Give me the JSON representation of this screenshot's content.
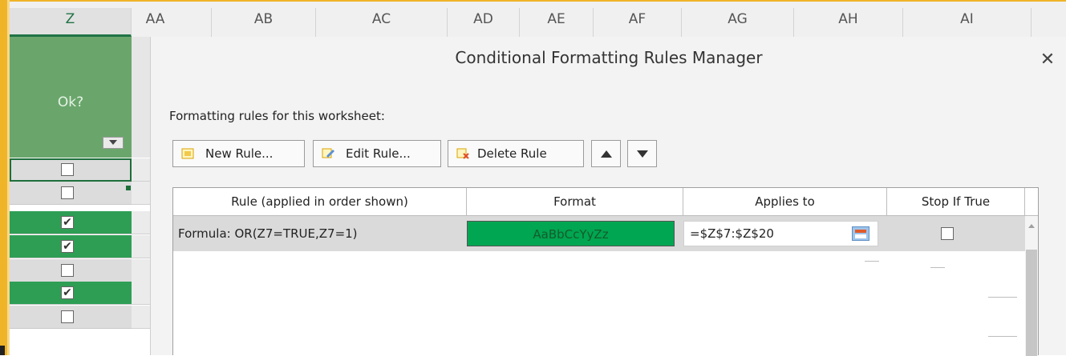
{
  "columns": [
    "Z",
    "AA",
    "AB",
    "AC",
    "AD",
    "AE",
    "AF",
    "AG",
    "AH",
    "AI"
  ],
  "selected_column": "Z",
  "z_column": {
    "header": "Ok?",
    "rows": [
      {
        "checked": false,
        "fill": "grey",
        "active": true
      },
      {
        "checked": false,
        "fill": "grey"
      },
      {
        "checked": true,
        "fill": "green"
      },
      {
        "checked": true,
        "fill": "green"
      },
      {
        "checked": false,
        "fill": "grey"
      },
      {
        "checked": true,
        "fill": "green"
      },
      {
        "checked": false,
        "fill": "grey"
      }
    ]
  },
  "dialog": {
    "title": "Conditional Formatting Rules Manager",
    "close_icon": "close-icon",
    "rules_label": "Formatting rules for this worksheet:",
    "toolbar": {
      "new_rule": "New Rule...",
      "edit_rule": "Edit Rule...",
      "delete_rule": "Delete Rule",
      "move_up_icon": "arrow-up-icon",
      "move_down_icon": "arrow-down-icon"
    },
    "table": {
      "headers": [
        "Rule (applied in order shown)",
        "Format",
        "Applies to",
        "Stop If True"
      ],
      "rows": [
        {
          "rule": "Formula: OR(Z7=TRUE,Z7=1)",
          "format_preview": "AaBbCcYyZz",
          "applies_to": "=$Z$7:$Z$20",
          "stop_if_true": false
        }
      ]
    }
  },
  "colors": {
    "accent_green": "#217346",
    "format_fill": "#00a651",
    "header_fill": "#6aa66b",
    "checked_row_fill": "#2e9e55"
  }
}
